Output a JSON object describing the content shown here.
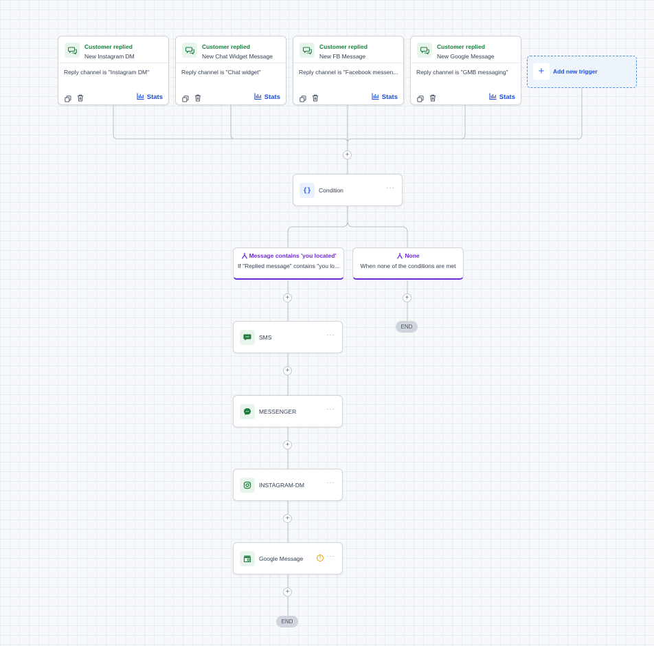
{
  "triggers": [
    {
      "title": "Customer replied",
      "subtitle": "New Instagram DM",
      "description": "Reply channel is \"Instagram DM\"",
      "stats_label": "Stats"
    },
    {
      "title": "Customer replied",
      "subtitle": "New Chat Widget Message",
      "description": "Reply channel is \"Chat widget\"",
      "stats_label": "Stats"
    },
    {
      "title": "Customer replied",
      "subtitle": "New FB Message",
      "description": "Reply channel is \"Facebook messen...",
      "stats_label": "Stats"
    },
    {
      "title": "Customer replied",
      "subtitle": "New Google Message",
      "description": "Reply channel is \"GMB messaging\"",
      "stats_label": "Stats"
    }
  ],
  "add_trigger": {
    "label": "Add new trigger",
    "icon": "+"
  },
  "add_step_icon": "+",
  "condition": {
    "label": "Condition",
    "icon": "{}",
    "menu_icon": "···"
  },
  "branches": [
    {
      "title": "Message contains 'you located'",
      "description": "If \"Replied message\" contains \"you lo..."
    },
    {
      "title": "None",
      "description": "When none of the conditions are met"
    }
  ],
  "actions": [
    {
      "label": "SMS",
      "icon": "sms-icon",
      "menu_icon": "···"
    },
    {
      "label": "MESSENGER",
      "icon": "messenger-icon",
      "menu_icon": "···"
    },
    {
      "label": "INSTAGRAM-DM",
      "icon": "instagram-icon",
      "menu_icon": "···"
    },
    {
      "label": "Google Message",
      "icon": "google-message-icon",
      "menu_icon": "···",
      "warning": "!"
    }
  ],
  "end_label": "END",
  "colors": {
    "trigger_title": "#15803d",
    "link_blue": "#1d4ed8",
    "branch_purple": "#6d28d9",
    "icon_green": "#1e7a3c",
    "warning": "#e0a100"
  }
}
